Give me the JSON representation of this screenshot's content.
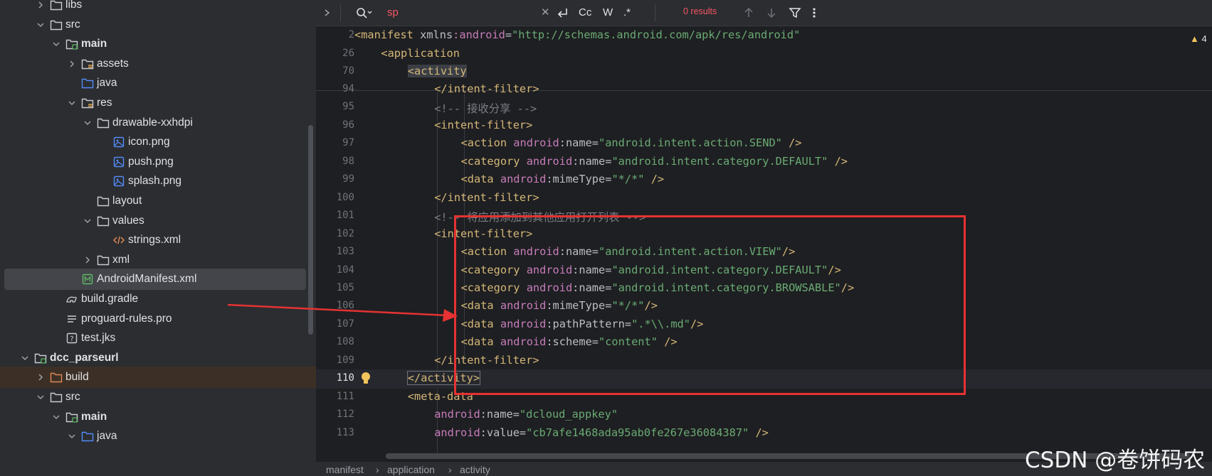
{
  "tree": {
    "items": [
      {
        "label": "libs",
        "icon": "folder-icon",
        "indent": 1,
        "arrow": "right"
      },
      {
        "label": "src",
        "icon": "folder-icon",
        "indent": 1,
        "arrow": "down"
      },
      {
        "label": "main",
        "icon": "folder-module-icon",
        "indent": 2,
        "arrow": "down",
        "bold": true
      },
      {
        "label": "assets",
        "icon": "folder-resource-icon",
        "indent": 3,
        "arrow": "right"
      },
      {
        "label": "java",
        "icon": "folder-source-icon",
        "indent": 3,
        "arrow": ""
      },
      {
        "label": "res",
        "icon": "folder-resource-icon",
        "indent": 3,
        "arrow": "down"
      },
      {
        "label": "drawable-xxhdpi",
        "icon": "folder-icon",
        "indent": 4,
        "arrow": "down"
      },
      {
        "label": "icon.png",
        "icon": "image-file-icon",
        "indent": 5,
        "arrow": ""
      },
      {
        "label": "push.png",
        "icon": "image-file-icon",
        "indent": 5,
        "arrow": ""
      },
      {
        "label": "splash.png",
        "icon": "image-file-icon",
        "indent": 5,
        "arrow": ""
      },
      {
        "label": "layout",
        "icon": "folder-icon",
        "indent": 4,
        "arrow": ""
      },
      {
        "label": "values",
        "icon": "folder-icon",
        "indent": 4,
        "arrow": "down"
      },
      {
        "label": "strings.xml",
        "icon": "xml-file-icon",
        "indent": 5,
        "arrow": ""
      },
      {
        "label": "xml",
        "icon": "folder-icon",
        "indent": 4,
        "arrow": "right"
      },
      {
        "label": "AndroidManifest.xml",
        "icon": "manifest-file-icon",
        "indent": 3,
        "arrow": "",
        "selected": true
      },
      {
        "label": "build.gradle",
        "icon": "gradle-file-icon",
        "indent": 2,
        "arrow": ""
      },
      {
        "label": "proguard-rules.pro",
        "icon": "text-file-icon",
        "indent": 2,
        "arrow": ""
      },
      {
        "label": "test.jks",
        "icon": "unknown-file-icon",
        "indent": 2,
        "arrow": ""
      },
      {
        "label": "dcc_parseurl",
        "icon": "folder-module-icon",
        "indent": 0,
        "arrow": "down",
        "bold": true
      },
      {
        "label": "build",
        "icon": "folder-excluded-icon",
        "indent": 1,
        "arrow": "right",
        "highlight": true
      },
      {
        "label": "src",
        "icon": "folder-icon",
        "indent": 1,
        "arrow": "down"
      },
      {
        "label": "main",
        "icon": "folder-module-icon",
        "indent": 2,
        "arrow": "down",
        "bold": true
      },
      {
        "label": "java",
        "icon": "folder-source-icon",
        "indent": 3,
        "arrow": "down"
      }
    ]
  },
  "findbar": {
    "query": "sp",
    "results": "0 results",
    "match_case": "Cc",
    "words": "W",
    "regex": ".*"
  },
  "sticky": [
    {
      "num": "2",
      "indent": 0,
      "tokens": [
        [
          "tag",
          "<manifest "
        ],
        [
          "an",
          "xmlns"
        ],
        [
          "ns",
          ":android"
        ],
        [
          "an",
          "="
        ],
        [
          "av",
          "\"http://schemas.android.com/apk/res/android\""
        ]
      ]
    },
    {
      "num": "26",
      "indent": 1,
      "tokens": [
        [
          "tag",
          "<application"
        ]
      ]
    },
    {
      "num": "70",
      "indent": 2,
      "tokens": [
        [
          "tagbox",
          "<activity"
        ]
      ]
    }
  ],
  "code": [
    {
      "num": "94",
      "indent": 3,
      "tokens": [
        [
          "tag",
          "</intent-filter>"
        ]
      ],
      "partial": true
    },
    {
      "num": "95",
      "indent": 3,
      "tokens": [
        [
          "cm",
          "<!-- 接收分享 -->"
        ]
      ]
    },
    {
      "num": "96",
      "indent": 3,
      "tokens": [
        [
          "tag",
          "<intent-filter>"
        ]
      ]
    },
    {
      "num": "97",
      "indent": 4,
      "tokens": [
        [
          "tag",
          "<action "
        ],
        [
          "ns",
          "android"
        ],
        [
          "an",
          ":name="
        ],
        [
          "av",
          "\"android.intent.action.SEND\""
        ],
        [
          "tag",
          " />"
        ]
      ]
    },
    {
      "num": "98",
      "indent": 4,
      "tokens": [
        [
          "tag",
          "<category "
        ],
        [
          "ns",
          "android"
        ],
        [
          "an",
          ":name="
        ],
        [
          "av",
          "\"android.intent.category.DEFAULT\""
        ],
        [
          "tag",
          " />"
        ]
      ]
    },
    {
      "num": "99",
      "indent": 4,
      "tokens": [
        [
          "tag",
          "<data "
        ],
        [
          "ns",
          "android"
        ],
        [
          "an",
          ":mimeType="
        ],
        [
          "av",
          "\"*/*\""
        ],
        [
          "tag",
          " />"
        ]
      ]
    },
    {
      "num": "100",
      "indent": 3,
      "tokens": [
        [
          "tag",
          "</intent-filter>"
        ]
      ]
    },
    {
      "num": "101",
      "indent": 3,
      "tokens": [
        [
          "cm",
          "<!-- 将应用添加到其他应用打开列表 -->"
        ]
      ]
    },
    {
      "num": "102",
      "indent": 3,
      "tokens": [
        [
          "tag",
          "<intent-filter>"
        ]
      ]
    },
    {
      "num": "103",
      "indent": 4,
      "tokens": [
        [
          "tag",
          "<action "
        ],
        [
          "ns",
          "android"
        ],
        [
          "an",
          ":name="
        ],
        [
          "av",
          "\"android.intent.action.VIEW\""
        ],
        [
          "tag",
          "/>"
        ]
      ]
    },
    {
      "num": "104",
      "indent": 4,
      "tokens": [
        [
          "tag",
          "<category "
        ],
        [
          "ns",
          "android"
        ],
        [
          "an",
          ":name="
        ],
        [
          "av",
          "\"android.intent.category.DEFAULT\""
        ],
        [
          "tag",
          "/>"
        ]
      ]
    },
    {
      "num": "105",
      "indent": 4,
      "tokens": [
        [
          "tag",
          "<category "
        ],
        [
          "ns",
          "android"
        ],
        [
          "an",
          ":name="
        ],
        [
          "av",
          "\"android.intent.category.BROWSABLE\""
        ],
        [
          "tag",
          "/>"
        ]
      ]
    },
    {
      "num": "106",
      "indent": 4,
      "tokens": [
        [
          "tag",
          "<data "
        ],
        [
          "ns",
          "android"
        ],
        [
          "an",
          ":mimeType="
        ],
        [
          "av",
          "\"*/*\""
        ],
        [
          "tag",
          "/>"
        ]
      ]
    },
    {
      "num": "107",
      "indent": 4,
      "tokens": [
        [
          "tag",
          "<data "
        ],
        [
          "ns",
          "android"
        ],
        [
          "an",
          ":pathPattern="
        ],
        [
          "av",
          "\".*\\\\.md\""
        ],
        [
          "tag",
          "/>"
        ]
      ]
    },
    {
      "num": "108",
      "indent": 4,
      "tokens": [
        [
          "tag",
          "<data "
        ],
        [
          "ns",
          "android"
        ],
        [
          "an",
          ":scheme="
        ],
        [
          "av",
          "\"content\""
        ],
        [
          "tag",
          " />"
        ]
      ]
    },
    {
      "num": "109",
      "indent": 3,
      "tokens": [
        [
          "tag",
          "</intent-filter>"
        ]
      ]
    },
    {
      "num": "110",
      "indent": 2,
      "tokens": [
        [
          "tagbox2",
          "</activity>"
        ]
      ],
      "current": true,
      "bulb": true
    },
    {
      "num": "111",
      "indent": 2,
      "tokens": [
        [
          "tag",
          "<meta-data"
        ]
      ]
    },
    {
      "num": "112",
      "indent": 3,
      "tokens": [
        [
          "ns",
          "android"
        ],
        [
          "an",
          ":name="
        ],
        [
          "av",
          "\"dcloud_appkey\""
        ]
      ]
    },
    {
      "num": "113",
      "indent": 3,
      "tokens": [
        [
          "ns",
          "android"
        ],
        [
          "an",
          ":value="
        ],
        [
          "av",
          "\"cb7afe1468ada95ab0fe267e36084387\""
        ],
        [
          "tag",
          " />"
        ]
      ],
      "partial": true
    }
  ],
  "breadcrumbs": [
    "manifest",
    "application",
    "activity"
  ],
  "warnings": "4",
  "watermark": "CSDN @卷饼码农",
  "colors": {
    "accent_red": "#e63232",
    "tag": "#d5b778",
    "string": "#6aab73",
    "attr_ns": "#c77dbb"
  }
}
